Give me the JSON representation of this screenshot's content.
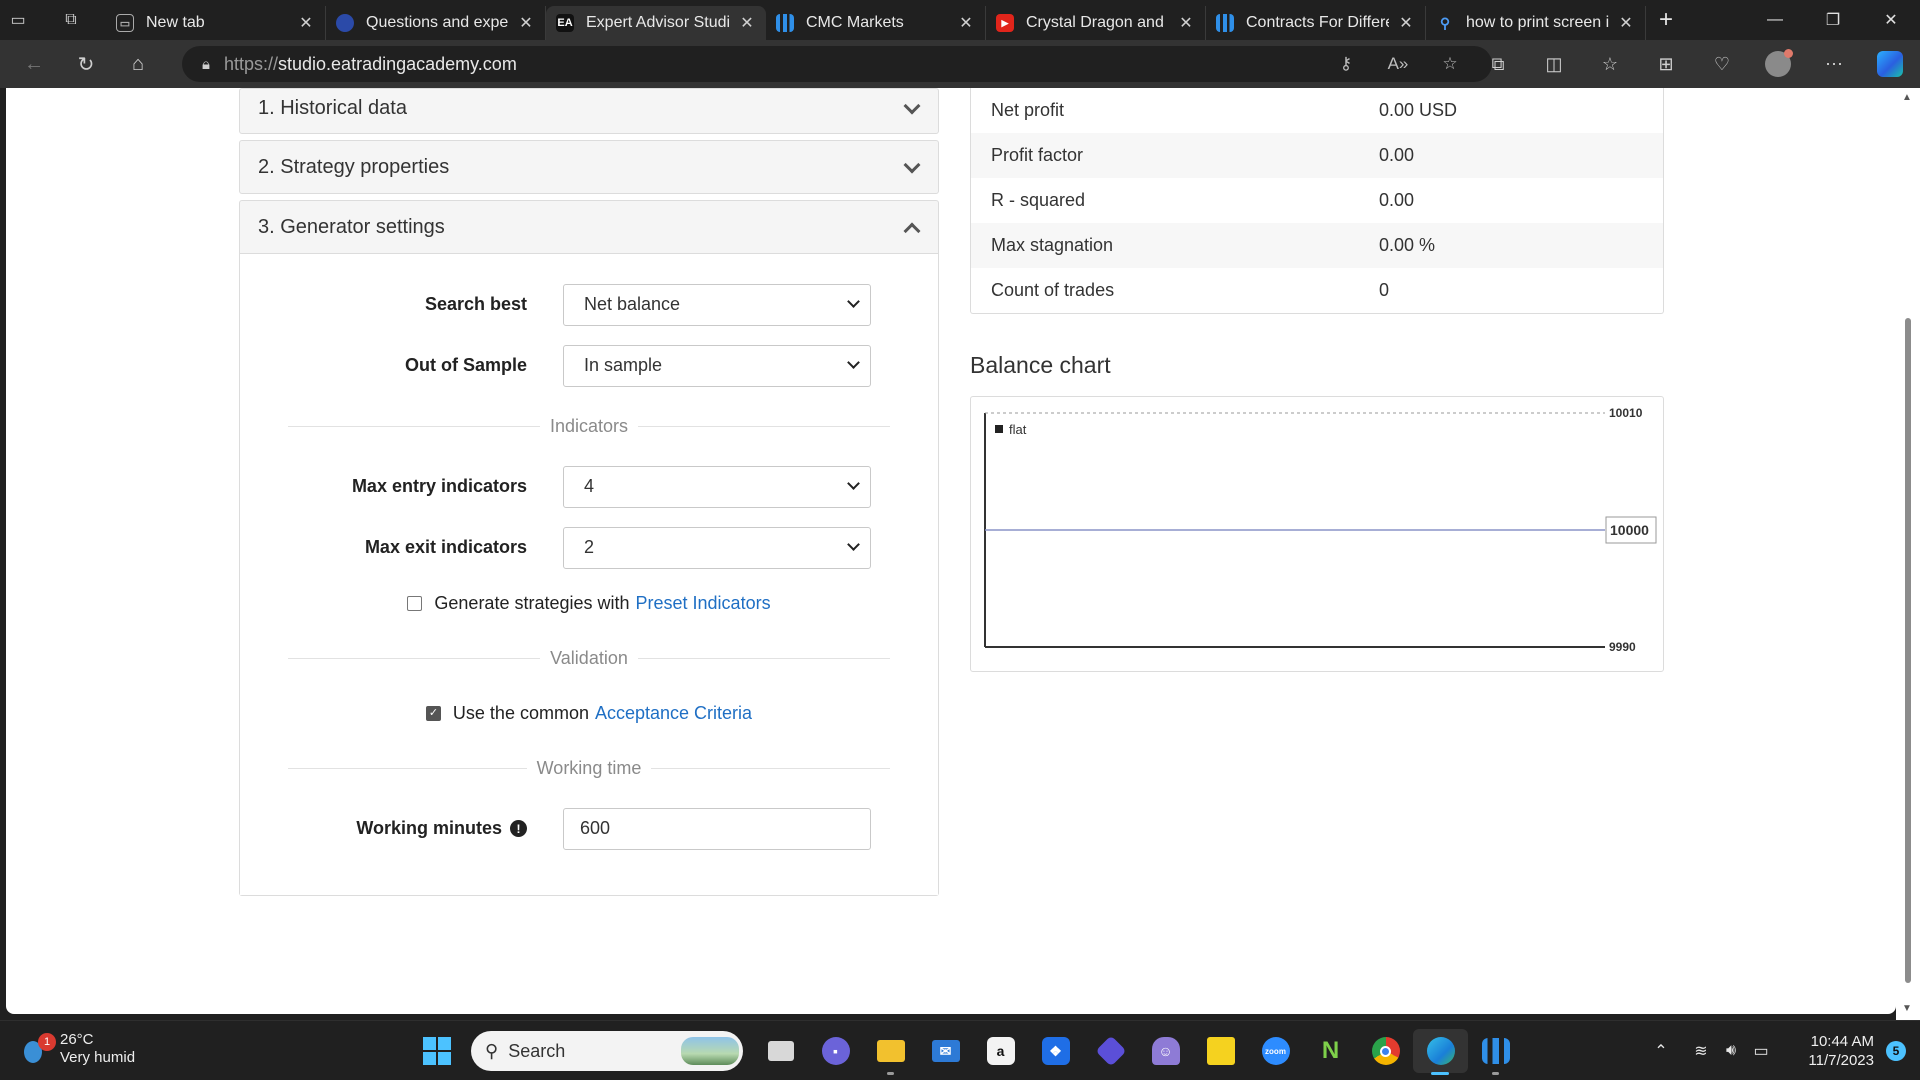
{
  "browser": {
    "tabs": [
      {
        "label": "New tab",
        "favicon": "newtab-icon",
        "active": false
      },
      {
        "label": "Questions and exper",
        "favicon": "globe-icon",
        "active": false
      },
      {
        "label": "Expert Advisor Studio",
        "favicon": "EA",
        "active": true
      },
      {
        "label": "CMC Markets",
        "favicon": "cmc-icon",
        "active": false
      },
      {
        "label": "Crystal Dragon and L",
        "favicon": "youtube-icon",
        "active": false
      },
      {
        "label": "Contracts For Differe",
        "favicon": "cmc-icon",
        "active": false
      },
      {
        "label": "how to print screen i",
        "favicon": "search-icon",
        "active": false
      }
    ],
    "url_scheme": "https://",
    "url_host": "studio.eatradingacademy.com"
  },
  "accordion": {
    "historical": "1. Historical data",
    "strategy": "2. Strategy properties",
    "generator": "3. Generator settings"
  },
  "generator": {
    "search_best_label": "Search best",
    "search_best_value": "Net balance",
    "oos_label": "Out of Sample",
    "oos_value": "In sample",
    "indicators_heading": "Indicators",
    "max_entry_label": "Max entry indicators",
    "max_entry_value": "4",
    "max_exit_label": "Max exit indicators",
    "max_exit_value": "2",
    "preset_text": "Generate strategies with",
    "preset_link": "Preset Indicators",
    "preset_checked": false,
    "validation_heading": "Validation",
    "acceptance_text": "Use the common",
    "acceptance_link": "Acceptance Criteria",
    "acceptance_checked": true,
    "working_time_heading": "Working time",
    "working_minutes_label": "Working minutes",
    "working_minutes_value": "600"
  },
  "stats": [
    {
      "label": "Net profit",
      "value": "0.00 USD"
    },
    {
      "label": "Profit factor",
      "value": "0.00"
    },
    {
      "label": "R - squared",
      "value": "0.00"
    },
    {
      "label": "Max stagnation",
      "value": "0.00 %"
    },
    {
      "label": "Count of trades",
      "value": "0"
    }
  ],
  "balance_chart_title": "Balance chart",
  "chart_data": {
    "type": "line",
    "legend": "flat",
    "y_ticks": [
      10010,
      9990
    ],
    "current_value_label": "10000",
    "series": [
      {
        "name": "flat",
        "values": [
          10000,
          10000
        ]
      }
    ],
    "ylim": [
      9990,
      10010
    ]
  },
  "taskbar": {
    "weather_temp": "26°C",
    "weather_desc": "Very humid",
    "weather_badge": "1",
    "search_placeholder": "Search",
    "time": "10:44 AM",
    "date": "11/7/2023",
    "notifications": "5"
  }
}
